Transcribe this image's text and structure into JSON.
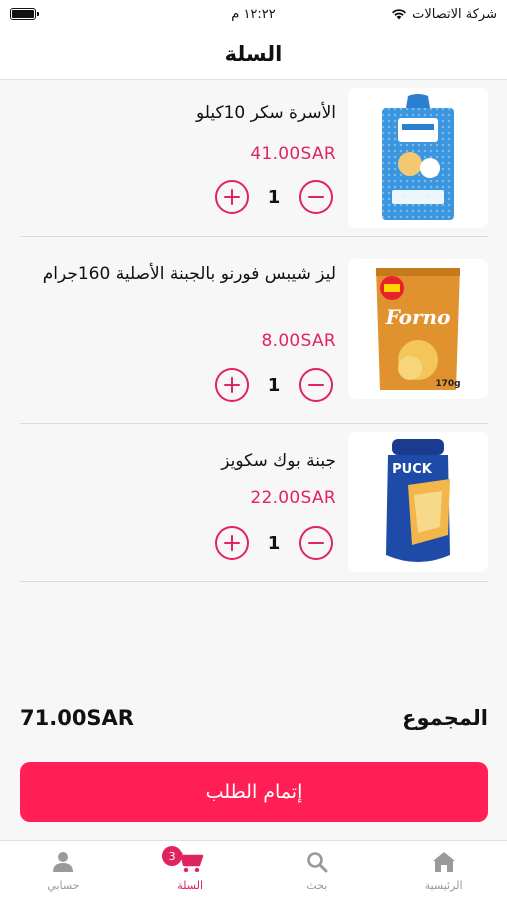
{
  "status_bar": {
    "carrier": "شركة الاتصالات",
    "time": "١٢:٢٢ م"
  },
  "header": {
    "title": "السلة"
  },
  "colors": {
    "accent": "#e0245e",
    "checkout": "#ff1f55",
    "tab_inactive": "#9a9a9a"
  },
  "cart": {
    "items": [
      {
        "name": "الأسرة سكر 10كيلو",
        "price": "41.00SAR",
        "quantity": "1",
        "image_icon": "sugar-bag-product-image"
      },
      {
        "name": "ليز شيبس فورنو بالجبنة الأصلية 160جرام",
        "price": "8.00SAR",
        "quantity": "1",
        "image_icon": "chips-bag-product-image",
        "image_text": "Forno",
        "image_weight": "170g"
      },
      {
        "name": "جبنة بوك سكويز",
        "price": "22.00SAR",
        "quantity": "1",
        "image_icon": "cheese-bottle-product-image",
        "image_text": "PUCK"
      }
    ]
  },
  "summary": {
    "total_label": "المجموع",
    "total_value": "71.00SAR"
  },
  "checkout": {
    "label": "إتمام الطلب"
  },
  "tabs": [
    {
      "label": "الرئيسية",
      "icon": "home-icon",
      "active": false
    },
    {
      "label": "بحث",
      "icon": "search-icon",
      "active": false
    },
    {
      "label": "السلة",
      "icon": "cart-icon",
      "active": true,
      "badge": "3"
    },
    {
      "label": "حسابي",
      "icon": "profile-icon",
      "active": false
    }
  ]
}
